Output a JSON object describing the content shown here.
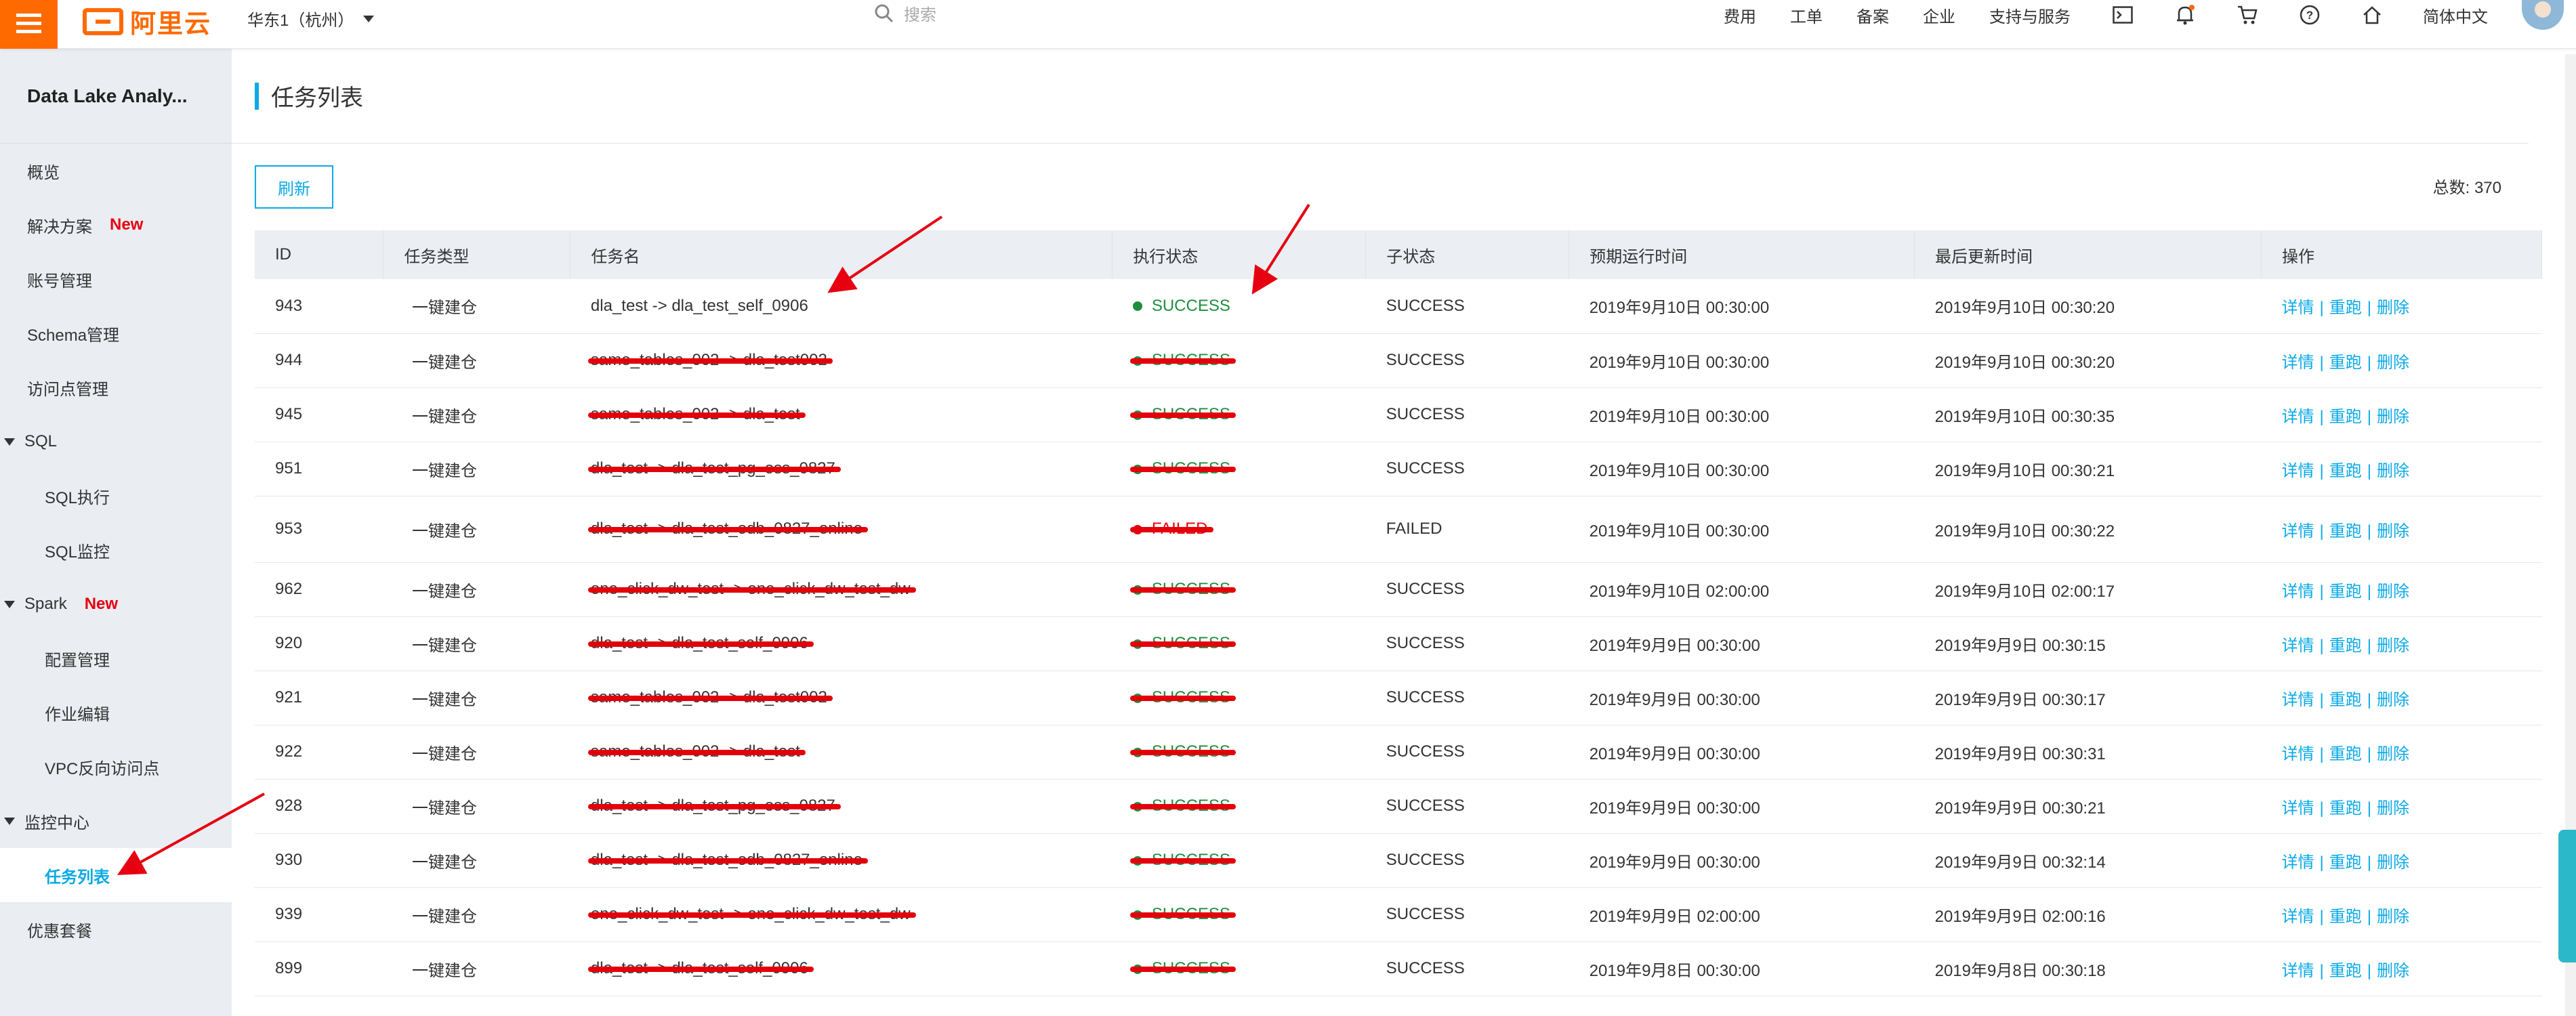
{
  "header": {
    "brand": "阿里云",
    "region": "华东1（杭州）",
    "search_placeholder": "搜索",
    "nav": [
      "费用",
      "工单",
      "备案",
      "企业",
      "支持与服务"
    ],
    "language": "简体中文",
    "accent": "#ff6a00"
  },
  "sidebar": {
    "title": "Data Lake Analy...",
    "items": [
      {
        "label": "概览"
      },
      {
        "label": "解决方案",
        "badge": "New"
      },
      {
        "label": "账号管理"
      },
      {
        "label": "Schema管理"
      },
      {
        "label": "访问点管理"
      },
      {
        "label": "SQL"
      },
      {
        "label": "SQL执行"
      },
      {
        "label": "SQL监控"
      },
      {
        "label": "Spark",
        "badge": "New"
      },
      {
        "label": "配置管理"
      },
      {
        "label": "作业编辑"
      },
      {
        "label": "VPC反向访问点"
      },
      {
        "label": "监控中心"
      },
      {
        "label": "任务列表"
      },
      {
        "label": "优惠套餐"
      }
    ]
  },
  "main": {
    "page_title": "任务列表",
    "refresh_label": "刷新",
    "total_label": "总数: 370",
    "columns": [
      "ID",
      "任务类型",
      "任务名",
      "执行状态",
      "子状态",
      "预期运行时间",
      "最后更新时间",
      "操作"
    ],
    "actions": {
      "detail": "详情",
      "rerun": "重跑",
      "delete": "删除",
      "sep": "|"
    },
    "rows": [
      {
        "id": "943",
        "type": "一键建仓",
        "name": "dla_test -> dla_test_self_0906",
        "status": "SUCCESS",
        "sub": "SUCCESS",
        "expected": "2019年9月10日 00:30:00",
        "updated": "2019年9月10日 00:30:20"
      },
      {
        "id": "944",
        "type": "一键建仓",
        "name": "same_tables_002 -> dla_test002",
        "status": "SUCCESS",
        "sub": "SUCCESS",
        "expected": "2019年9月10日 00:30:00",
        "updated": "2019年9月10日 00:30:20"
      },
      {
        "id": "945",
        "type": "一键建仓",
        "name": "same_tables_002 -> dla_test",
        "status": "SUCCESS",
        "sub": "SUCCESS",
        "expected": "2019年9月10日 00:30:00",
        "updated": "2019年9月10日 00:30:35"
      },
      {
        "id": "951",
        "type": "一键建仓",
        "name": "dla_test -> dla_test_pg_oss_0827",
        "status": "SUCCESS",
        "sub": "SUCCESS",
        "expected": "2019年9月10日 00:30:00",
        "updated": "2019年9月10日 00:30:21"
      },
      {
        "id": "953",
        "type": "一键建仓",
        "name": "dla_test -> dla_test_odb_0827_online",
        "status": "FAILED",
        "sub": "FAILED",
        "expected": "2019年9月10日 00:30:00",
        "updated": "2019年9月10日 00:30:22"
      },
      {
        "id": "962",
        "type": "一键建仓",
        "name": "one_click_dw_test -> one_click_dw_test_dw",
        "status": "SUCCESS",
        "sub": "SUCCESS",
        "expected": "2019年9月10日 02:00:00",
        "updated": "2019年9月10日 02:00:17"
      },
      {
        "id": "920",
        "type": "一键建仓",
        "name": "dla_test -> dla_test_self_0906",
        "status": "SUCCESS",
        "sub": "SUCCESS",
        "expected": "2019年9月9日 00:30:00",
        "updated": "2019年9月9日 00:30:15"
      },
      {
        "id": "921",
        "type": "一键建仓",
        "name": "same_tables_002 -> dla_test002",
        "status": "SUCCESS",
        "sub": "SUCCESS",
        "expected": "2019年9月9日 00:30:00",
        "updated": "2019年9月9日 00:30:17"
      },
      {
        "id": "922",
        "type": "一键建仓",
        "name": "same_tables_002 -> dla_test",
        "status": "SUCCESS",
        "sub": "SUCCESS",
        "expected": "2019年9月9日 00:30:00",
        "updated": "2019年9月9日 00:30:31"
      },
      {
        "id": "928",
        "type": "一键建仓",
        "name": "dla_test -> dla_test_pg_oss_0827",
        "status": "SUCCESS",
        "sub": "SUCCESS",
        "expected": "2019年9月9日 00:30:00",
        "updated": "2019年9月9日 00:30:21"
      },
      {
        "id": "930",
        "type": "一键建仓",
        "name": "dla_test -> dla_test_odb_0827_online",
        "status": "SUCCESS",
        "sub": "SUCCESS",
        "expected": "2019年9月9日 00:30:00",
        "updated": "2019年9月9日 00:32:14"
      },
      {
        "id": "939",
        "type": "一键建仓",
        "name": "one_click_dw_test -> one_click_dw_test_dw",
        "status": "SUCCESS",
        "sub": "SUCCESS",
        "expected": "2019年9月9日 02:00:00",
        "updated": "2019年9月9日 02:00:16"
      },
      {
        "id": "899",
        "type": "一键建仓",
        "name": "dla_test -> dla_test_self_0906",
        "status": "SUCCESS",
        "sub": "SUCCESS",
        "expected": "2019年9月8日 00:30:00",
        "updated": "2019年9月8日 00:30:18"
      }
    ]
  }
}
